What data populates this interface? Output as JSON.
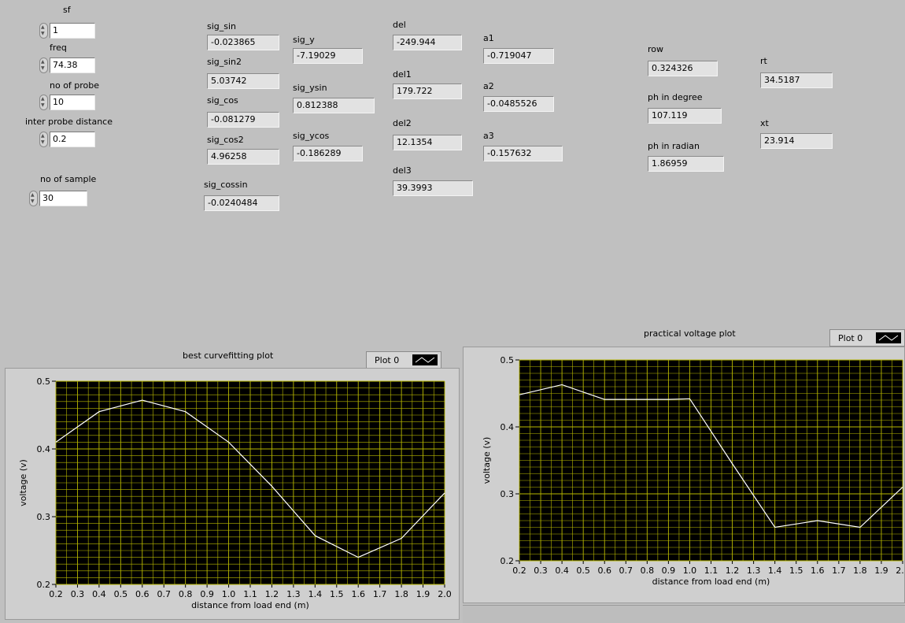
{
  "controls": {
    "sf": {
      "label": "sf",
      "value": "1"
    },
    "freq": {
      "label": "freq",
      "value": "74.38"
    },
    "no_of_probe": {
      "label": "no of probe",
      "value": "10"
    },
    "inter_probe_distance": {
      "label": "inter probe distance",
      "value": "0.2"
    },
    "no_of_sample": {
      "label": "no of sample",
      "value": "30"
    }
  },
  "indicators": {
    "sig_sin": {
      "label": "sig_sin",
      "value": "-0.023865"
    },
    "sig_sin2": {
      "label": "sig_sin2",
      "value": "5.03742"
    },
    "sig_cos": {
      "label": "sig_cos",
      "value": "-0.081279"
    },
    "sig_cos2": {
      "label": "sig_cos2",
      "value": "4.96258"
    },
    "sig_cossin": {
      "label": "sig_cossin",
      "value": "-0.0240484"
    },
    "sig_y": {
      "label": "sig_y",
      "value": "-7.19029"
    },
    "sig_ysin": {
      "label": "sig_ysin",
      "value": "0.812388"
    },
    "sig_ycos": {
      "label": "sig_ycos",
      "value": "-0.186289"
    },
    "del": {
      "label": "del",
      "value": "-249.944"
    },
    "del1": {
      "label": "del1",
      "value": "179.722"
    },
    "del2": {
      "label": "del2",
      "value": "12.1354"
    },
    "del3": {
      "label": "del3",
      "value": "39.3993"
    },
    "a1": {
      "label": "a1",
      "value": "-0.719047"
    },
    "a2": {
      "label": "a2",
      "value": "-0.0485526"
    },
    "a3": {
      "label": "a3",
      "value": "-0.157632"
    },
    "row": {
      "label": "row",
      "value": "0.324326"
    },
    "ph_in_degree": {
      "label": "ph in degree",
      "value": "107.119"
    },
    "ph_in_radian": {
      "label": "ph in radian",
      "value": "1.86959"
    },
    "rt": {
      "label": "rt",
      "value": "34.5187"
    },
    "xt": {
      "label": "xt",
      "value": "23.914"
    }
  },
  "graphs": {
    "left": {
      "title": "best curvefitting plot",
      "legend": "Plot 0"
    },
    "right": {
      "title": "practical voltage plot",
      "legend": "Plot 0"
    }
  },
  "chart_data": [
    {
      "type": "line",
      "title": "best curvefitting plot",
      "xlabel": "distance from load end (m)",
      "ylabel": "voltage (v)",
      "xlim": [
        0.2,
        2.0
      ],
      "ylim": [
        0.2,
        0.5
      ],
      "x_ticks": [
        "0.2",
        "0.3",
        "0.4",
        "0.5",
        "0.6",
        "0.7",
        "0.8",
        "0.9",
        "1.0",
        "1.1",
        "1.2",
        "1.3",
        "1.4",
        "1.5",
        "1.6",
        "1.7",
        "1.8",
        "1.9",
        "2.0"
      ],
      "y_ticks": [
        "0.2",
        "0.3",
        "0.4",
        "0.5"
      ],
      "grid": true,
      "legend": "top-right",
      "colors": {
        "background": "#000000",
        "grid": "#b8b800",
        "line": "#ffffff"
      },
      "series": [
        {
          "name": "Plot 0",
          "x": [
            0.2,
            0.4,
            0.6,
            0.8,
            1.0,
            1.2,
            1.4,
            1.6,
            1.8,
            2.0
          ],
          "y": [
            0.41,
            0.455,
            0.472,
            0.455,
            0.41,
            0.345,
            0.272,
            0.24,
            0.268,
            0.335
          ]
        }
      ]
    },
    {
      "type": "line",
      "title": "practical voltage plot",
      "xlabel": "distance from load end (m)",
      "ylabel": "voltage (v)",
      "xlim": [
        0.2,
        2.0
      ],
      "ylim": [
        0.2,
        0.5
      ],
      "x_ticks": [
        "0.2",
        "0.3",
        "0.4",
        "0.5",
        "0.6",
        "0.7",
        "0.8",
        "0.9",
        "1.0",
        "1.1",
        "1.2",
        "1.3",
        "1.4",
        "1.5",
        "1.6",
        "1.7",
        "1.8",
        "1.9",
        "2.0"
      ],
      "y_ticks": [
        "0.2",
        "0.3",
        "0.4",
        "0.5"
      ],
      "grid": true,
      "legend": "top-right",
      "colors": {
        "background": "#000000",
        "grid": "#b8b800",
        "line": "#ffffff"
      },
      "series": [
        {
          "name": "Plot 0",
          "x": [
            0.2,
            0.4,
            0.6,
            0.8,
            0.9,
            1.0,
            1.2,
            1.4,
            1.6,
            1.8,
            2.0
          ],
          "y": [
            0.448,
            0.463,
            0.441,
            0.441,
            0.441,
            0.442,
            0.345,
            0.25,
            0.26,
            0.25,
            0.31
          ]
        }
      ]
    }
  ]
}
